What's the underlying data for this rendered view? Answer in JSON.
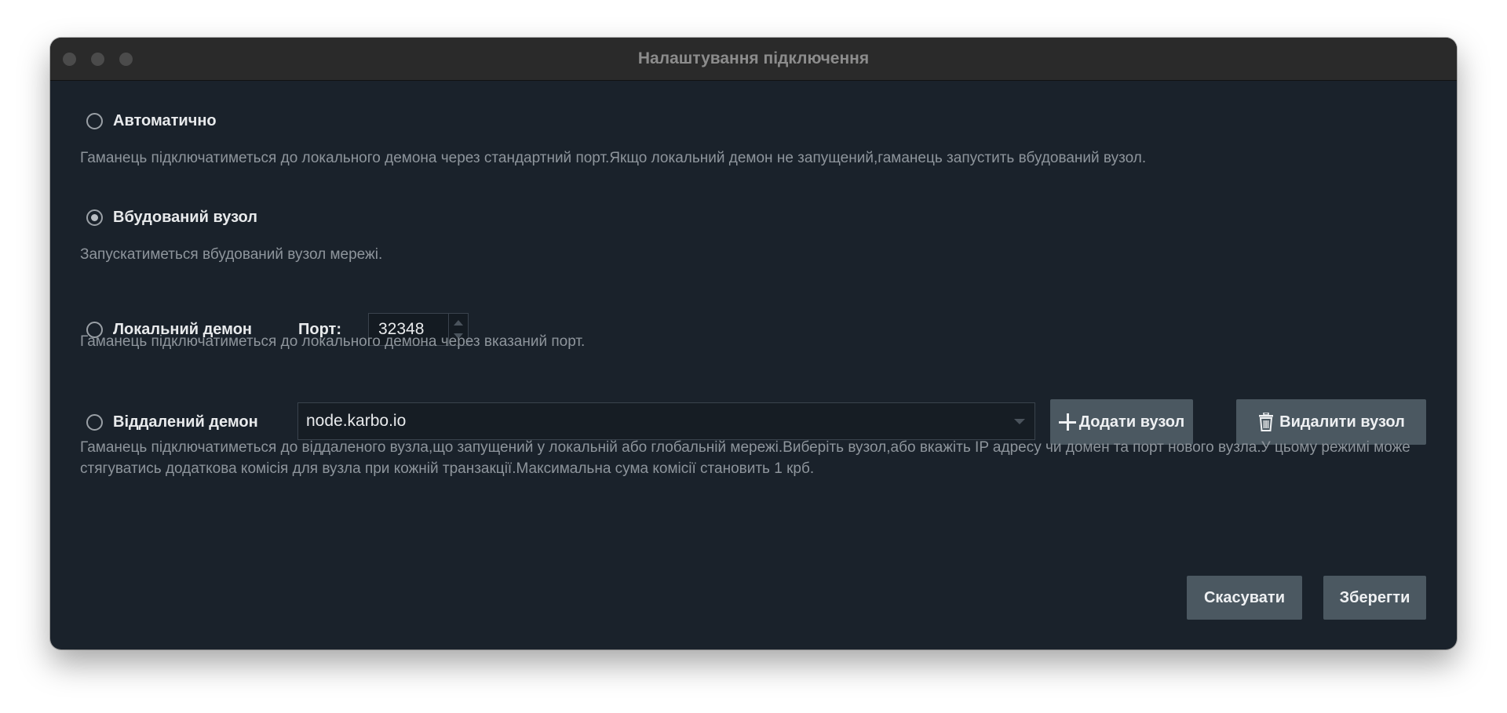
{
  "window": {
    "title": "Налаштування підключення"
  },
  "options": {
    "auto": {
      "label": "Автоматично",
      "description": "Гаманець підключатиметься до локального демона через стандартний порт.Якщо локальний демон не запущений,гаманець запустить вбудований вузол.",
      "selected": false
    },
    "embedded": {
      "label": "Вбудований вузол",
      "description": "Запускатиметься вбудований вузол мережі.",
      "selected": true
    },
    "local": {
      "label": "Локальний демон",
      "port_label": "Порт:",
      "port_value": "32348",
      "description": "Гаманець підключатиметься до локального демона через вказаний порт.",
      "selected": false
    },
    "remote": {
      "label": "Віддалений демон",
      "node_value": "node.karbo.io",
      "add_label": "Додати вузол",
      "remove_label": "Видалити вузол",
      "description": "Гаманець підключатиметься до віддаленого вузла,що запущений у локальній або глобальній мережі.Виберіть вузол,або вкажіть IP адресу чи домен та порт нового вузла.У цьому режимі може стягуватись додаткова комісія для вузла при кожній транзакції.Максимальна сума комісії становить 1 крб.",
      "selected": false
    }
  },
  "actions": {
    "cancel_label": "Скасувати",
    "save_label": "Зберегти"
  },
  "icons": {
    "add": "plus-icon",
    "remove": "trash-icon"
  },
  "colors": {
    "background": "#1a222b",
    "button": "#4b5861",
    "titlebar": "#2a2a2a"
  }
}
